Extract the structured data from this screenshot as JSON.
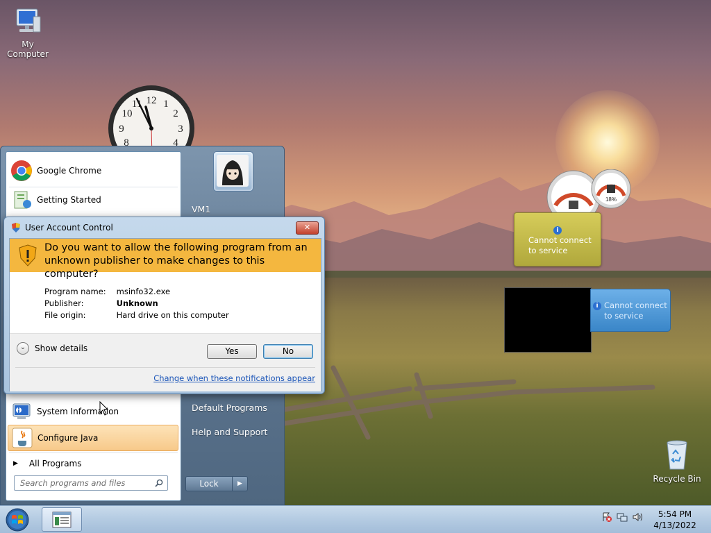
{
  "desktop": {
    "icons": {
      "my_computer": "My Computer",
      "recycle_bin": "Recycle Bin"
    },
    "gadgets": {
      "clock": {
        "numbers": [
          "12",
          "1",
          "2",
          "3",
          "4",
          "8",
          "9",
          "10",
          "11"
        ],
        "time": "5:54"
      },
      "meter": {
        "percent_label": "18%"
      },
      "weather": {
        "message": "Cannot connect to service"
      },
      "feed": {
        "message": "Cannot connect to service"
      }
    }
  },
  "start_menu": {
    "user_name": "VM1",
    "pinned_items": [
      {
        "label": "Google Chrome",
        "icon": "chrome-icon"
      },
      {
        "label": "Getting Started",
        "icon": "getting-started-icon"
      }
    ],
    "recent_items": [
      {
        "label": "System Information",
        "icon": "system-info-icon"
      },
      {
        "label": "Configure Java",
        "icon": "java-icon",
        "highlighted": true
      }
    ],
    "all_programs": "All Programs",
    "search_placeholder": "Search programs and files",
    "right_links": {
      "default_programs": "Default Programs",
      "help_and_support": "Help and Support"
    },
    "power_button": "Lock"
  },
  "uac_dialog": {
    "title": "User Account Control",
    "question": "Do you want to allow the following program from an unknown publisher to make changes to this computer?",
    "fields": [
      {
        "label": "Program name:",
        "value": "msinfo32.exe",
        "bold": false
      },
      {
        "label": "Publisher:",
        "value": "Unknown",
        "bold": true
      },
      {
        "label": "File origin:",
        "value": "Hard drive on this computer",
        "bold": false
      }
    ],
    "show_details": "Show details",
    "yes_button": "Yes",
    "no_button": "No",
    "settings_link": "Change when these notifications appear"
  },
  "taskbar": {
    "time": "5:54 PM",
    "date": "4/13/2022"
  },
  "colors": {
    "uac_banner": "#f4b73f",
    "link": "#1b55b8",
    "start_menu_blue": "#5e7690",
    "highlight_orange": "#f7c98a"
  }
}
